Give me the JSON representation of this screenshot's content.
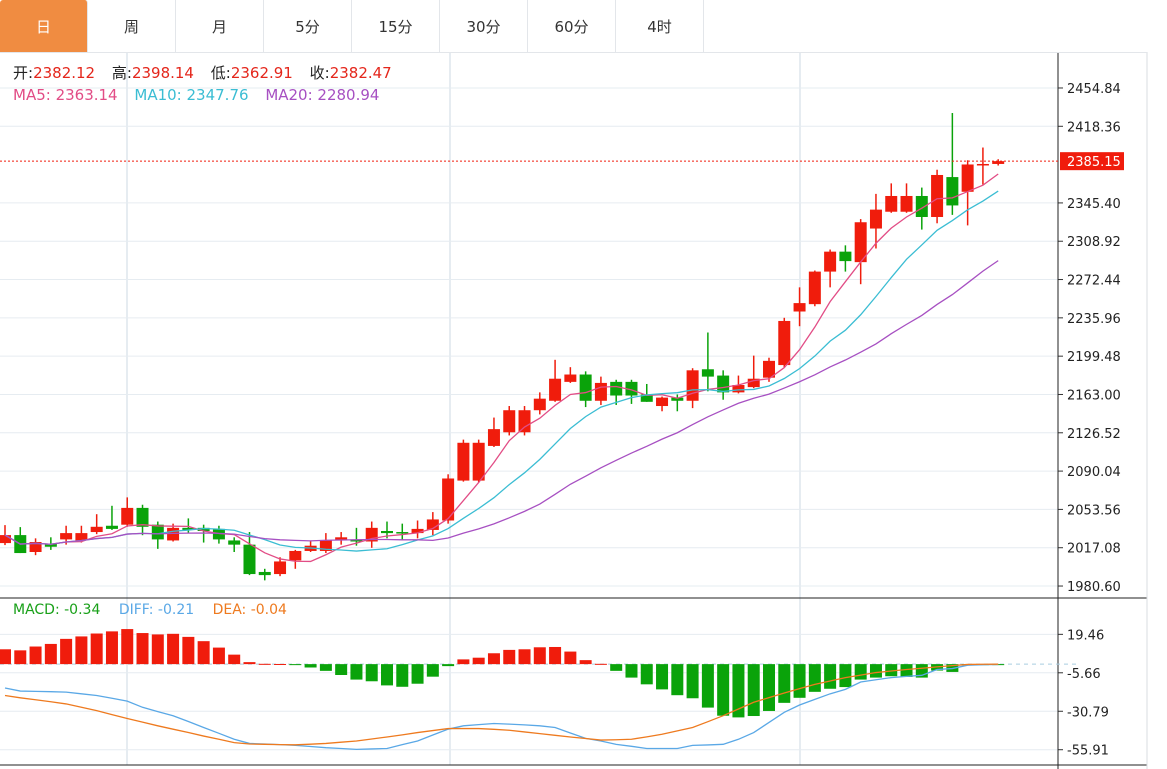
{
  "tabs": [
    {
      "label": "日",
      "active": true
    },
    {
      "label": "周"
    },
    {
      "label": "月"
    },
    {
      "label": "5分"
    },
    {
      "label": "15分"
    },
    {
      "label": "30分"
    },
    {
      "label": "60分"
    },
    {
      "label": "4时"
    }
  ],
  "ohlc_info": {
    "open_label": "开:",
    "open": "2382.12",
    "high_label": "高:",
    "high": "2398.14",
    "low_label": "低:",
    "low": "2362.91",
    "close_label": "收:",
    "close": "2382.47"
  },
  "ma_info": {
    "ma5": "MA5: 2363.14",
    "ma10": "MA10: 2347.76",
    "ma20": "MA20: 2280.94"
  },
  "macd_info": {
    "macd": "MACD: -0.34",
    "diff": "DIFF: -0.21",
    "dea": "DEA: -0.04"
  },
  "colors": {
    "up": "#f01c0c",
    "down": "#0aa30a",
    "ma5": "#e24d86",
    "ma10": "#3bbdd3",
    "ma20": "#a750c2",
    "diff": "#5aa8e6",
    "dea": "#ee7a1f",
    "active_tab": "#f08c41"
  },
  "chart_data": [
    {
      "type": "candlestick",
      "ylim": [
        1969.2,
        2489.1
      ],
      "y_ticks": [
        "2454.84",
        "2418.36",
        "2345.40",
        "2308.92",
        "2272.44",
        "2235.96",
        "2199.48",
        "2163.00",
        "2126.52",
        "2090.04",
        "2053.56",
        "2017.08",
        "1980.60"
      ],
      "current_price": "2385.15",
      "ma_periods": [
        5,
        10,
        20
      ],
      "ohlc": [
        [
          2021.5,
          2038.6,
          2019.6,
          2029.1
        ],
        [
          2029.1,
          2036.7,
          2012.0,
          2012.0
        ],
        [
          2013,
          2026,
          2010,
          2022.5
        ],
        [
          2021,
          2027,
          2015,
          2018
        ],
        [
          2025,
          2038,
          2020,
          2031
        ],
        [
          2024,
          2038,
          2022,
          2031
        ],
        [
          2032,
          2049,
          2030,
          2037
        ],
        [
          2038,
          2057,
          2034,
          2035
        ],
        [
          2039,
          2065,
          2037,
          2055
        ],
        [
          2055,
          2058,
          2029,
          2037
        ],
        [
          2039,
          2042,
          2016,
          2025
        ],
        [
          2024,
          2040,
          2023,
          2036
        ],
        [
          2036,
          2045,
          2031,
          2034
        ],
        [
          2036,
          2039,
          2022,
          2033
        ],
        [
          2035,
          2038,
          2021,
          2025
        ],
        [
          2024,
          2027,
          2013,
          2020
        ],
        [
          2020,
          2032,
          1991,
          1992
        ],
        [
          1994,
          1997,
          1986,
          1991
        ],
        [
          1992,
          2008,
          1990,
          2004
        ],
        [
          2005,
          2015,
          1997,
          2014
        ],
        [
          2014,
          2024,
          2013,
          2019
        ],
        [
          2014,
          2031,
          2012,
          2024
        ],
        [
          2024,
          2032,
          2020,
          2027
        ],
        [
          2025,
          2036,
          2019,
          2023
        ],
        [
          2023,
          2042,
          2017,
          2036
        ],
        [
          2033,
          2042,
          2026,
          2031
        ],
        [
          2032,
          2040,
          2024,
          2031
        ],
        [
          2031,
          2043,
          2026,
          2035
        ],
        [
          2034,
          2051,
          2029,
          2044
        ],
        [
          2043,
          2087,
          2040,
          2083
        ],
        [
          2081,
          2120,
          2080,
          2117
        ],
        [
          2081,
          2120,
          2079,
          2117
        ],
        [
          2114,
          2141,
          2113,
          2130
        ],
        [
          2127,
          2152,
          2124,
          2148
        ],
        [
          2127,
          2152,
          2124,
          2148
        ],
        [
          2148,
          2165,
          2144,
          2159
        ],
        [
          2157,
          2196,
          2156,
          2178
        ],
        [
          2175,
          2189,
          2174,
          2182
        ],
        [
          2182,
          2185,
          2151,
          2157
        ],
        [
          2157,
          2180,
          2153,
          2174
        ],
        [
          2175,
          2177,
          2153,
          2162
        ],
        [
          2175,
          2177,
          2154,
          2162
        ],
        [
          2163,
          2173,
          2156,
          2156
        ],
        [
          2152,
          2161,
          2147,
          2160
        ],
        [
          2160,
          2163,
          2147,
          2157
        ],
        [
          2157,
          2188,
          2150,
          2186
        ],
        [
          2187,
          2222,
          2166,
          2180
        ],
        [
          2181,
          2186,
          2158,
          2165
        ],
        [
          2165,
          2181,
          2164,
          2172
        ],
        [
          2170,
          2200,
          2169,
          2178
        ],
        [
          2179,
          2198,
          2175,
          2195
        ],
        [
          2191,
          2236,
          2189,
          2233
        ],
        [
          2242,
          2265,
          2228,
          2250
        ],
        [
          2249,
          2281,
          2247,
          2280
        ],
        [
          2280,
          2301,
          2265,
          2299
        ],
        [
          2299,
          2305,
          2280,
          2290
        ],
        [
          2289,
          2330,
          2268,
          2327
        ],
        [
          2321,
          2354,
          2302,
          2339
        ],
        [
          2337,
          2364,
          2336,
          2352
        ],
        [
          2337,
          2364,
          2336,
          2352
        ],
        [
          2352,
          2360,
          2320,
          2332
        ],
        [
          2332,
          2377,
          2326,
          2372
        ],
        [
          2370,
          2431,
          2334,
          2343
        ],
        [
          2356,
          2386,
          2324,
          2382
        ],
        [
          2382.12,
          2398.14,
          2362.91,
          2382.47
        ],
        [
          2382.5,
          2387,
          2381,
          2385.15
        ]
      ]
    },
    {
      "type": "macd",
      "ylim": [
        -65.9,
        43.2
      ],
      "y_ticks": [
        "19.46",
        "-5.66",
        "-30.79",
        "-55.91"
      ],
      "macd": [
        9.7,
        9.0,
        11.5,
        13.2,
        16.5,
        18.1,
        20.0,
        21.4,
        22.9,
        20.3,
        19.4,
        19.8,
        17.8,
        15.0,
        10.8,
        6.2,
        1.3,
        0.2,
        0.1,
        -0.3,
        -2.2,
        -4.4,
        -7.1,
        -10.1,
        -11.2,
        -13.9,
        -14.8,
        -12.8,
        -8.2,
        -1.3,
        3.1,
        4.2,
        7.1,
        9.3,
        9.7,
        11.0,
        11.2,
        8.2,
        2.6,
        0.2,
        -4.4,
        -8.8,
        -13.2,
        -16.5,
        -20.3,
        -22.3,
        -28.4,
        -33.7,
        -34.8,
        -33.9,
        -30.6,
        -25.3,
        -22.0,
        -18.1,
        -16.1,
        -15.0,
        -10.1,
        -8.8,
        -7.9,
        -8.4,
        -8.8,
        -4.2,
        -5.1,
        -0.3,
        -0.2,
        -0.34
      ],
      "diff": [
        -15.6,
        -17.6,
        -17.8,
        -18.0,
        -18.3,
        -19.4,
        -20.5,
        -22.3,
        -24.2,
        -28.2,
        -31.0,
        -33.7,
        -37.5,
        -41.4,
        -45.2,
        -49.1,
        -51.8,
        -52.2,
        -52.6,
        -53.1,
        -53.8,
        -54.6,
        -55.1,
        -55.7,
        -55.4,
        -55.1,
        -52.6,
        -50.2,
        -46.3,
        -42.5,
        -40.3,
        -39.5,
        -38.8,
        -39.2,
        -39.7,
        -40.3,
        -41.4,
        -45.0,
        -48.5,
        -50.2,
        -52.4,
        -53.7,
        -55.1,
        -55.1,
        -55.1,
        -53.1,
        -52.8,
        -52.4,
        -49.1,
        -44.7,
        -38.1,
        -31.5,
        -26.7,
        -23.0,
        -19.4,
        -16.5,
        -11.7,
        -10.2,
        -8.8,
        -8.0,
        -7.3,
        -3.5,
        -2.9,
        -0.7,
        -0.4,
        -0.21
      ],
      "dea": [
        -20.5,
        -22.0,
        -23.3,
        -24.6,
        -26.0,
        -28.2,
        -30.4,
        -33.0,
        -35.5,
        -37.9,
        -40.3,
        -42.5,
        -44.7,
        -47.0,
        -49.1,
        -51.3,
        -52.2,
        -52.4,
        -52.6,
        -52.7,
        -52.3,
        -51.8,
        -51.0,
        -50.2,
        -48.9,
        -47.6,
        -46.2,
        -44.7,
        -43.4,
        -42.1,
        -42.1,
        -42.1,
        -42.6,
        -43.2,
        -44.3,
        -45.4,
        -46.5,
        -47.6,
        -48.6,
        -49.6,
        -49.4,
        -49.1,
        -47.5,
        -45.8,
        -43.6,
        -41.4,
        -37.6,
        -33.7,
        -29.3,
        -24.9,
        -21.9,
        -18.9,
        -16.0,
        -13.2,
        -11.0,
        -8.8,
        -7.2,
        -5.5,
        -4.5,
        -3.5,
        -2.7,
        -1.8,
        -1.0,
        -0.2,
        -0.1,
        -0.04
      ]
    }
  ]
}
